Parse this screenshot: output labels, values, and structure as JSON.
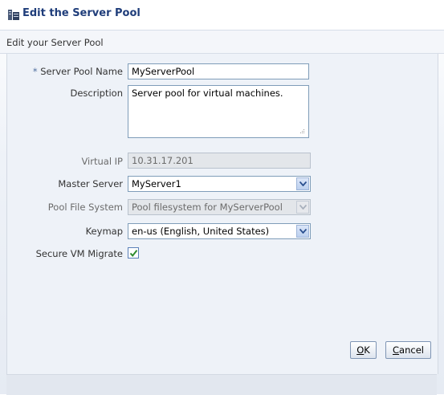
{
  "dialog": {
    "title": "Edit the Server Pool",
    "subtitle": "Edit your Server Pool"
  },
  "form": {
    "server_pool_name": {
      "required_marker": "*",
      "label": "Server Pool Name",
      "value": "MyServerPool"
    },
    "description": {
      "label": "Description",
      "value": "Server pool for virtual machines."
    },
    "virtual_ip": {
      "label": "Virtual IP",
      "value": "10.31.17.201"
    },
    "master_server": {
      "label": "Master Server",
      "value": "MyServer1"
    },
    "pool_file_system": {
      "label": "Pool File System",
      "value": "Pool filesystem for MyServerPool"
    },
    "keymap": {
      "label": "Keymap",
      "value": "en-us (English, United States)"
    },
    "secure_vm_migrate": {
      "label": "Secure VM Migrate",
      "checked": true
    }
  },
  "buttons": {
    "ok": {
      "mnemonic": "O",
      "rest": "K"
    },
    "cancel": {
      "mnemonic": "C",
      "rest": "ancel"
    }
  },
  "icons": {
    "title": "server-pool-icon",
    "dropdown": "chevron-down-icon",
    "check": "checkmark-icon",
    "resize": "resize-grip-icon"
  },
  "colors": {
    "title_text": "#1f3d7a",
    "field_border": "#7f9db9",
    "disabled_field": "#e3e6ea",
    "background": "#eef2f8"
  }
}
